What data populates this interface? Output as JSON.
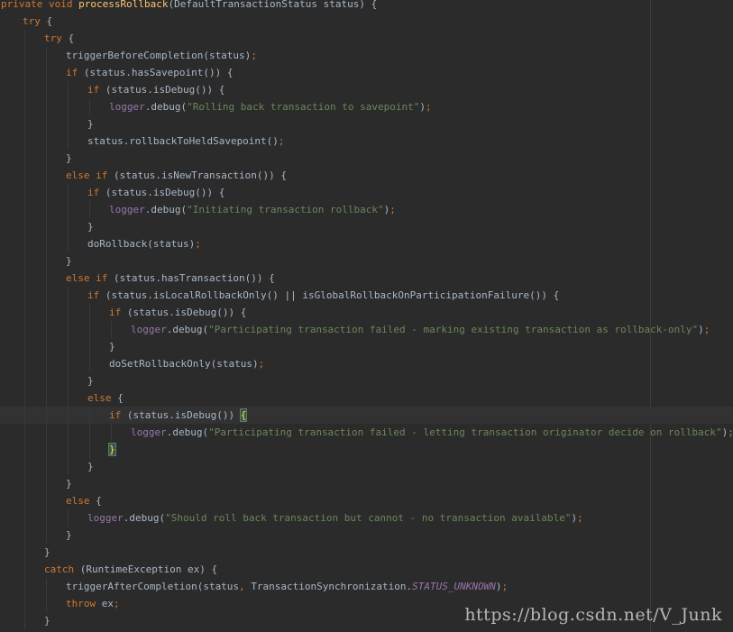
{
  "editor": {
    "colors": {
      "background": "#2b2b2b",
      "keyword": "#cc7832",
      "method": "#ffc66d",
      "string": "#6a8759",
      "field": "#9876aa",
      "text": "#a9b7c6"
    },
    "lines": [
      {
        "indent": 1,
        "tokens": [
          {
            "t": "private ",
            "c": "kw"
          },
          {
            "t": "void ",
            "c": "kw"
          },
          {
            "t": "processRollback",
            "c": "fn"
          },
          {
            "t": "(DefaultTransactionStatus status) {"
          }
        ]
      },
      {
        "indent": 2,
        "tokens": [
          {
            "t": "try ",
            "c": "kw"
          },
          {
            "t": "{"
          }
        ]
      },
      {
        "indent": 3,
        "tokens": [
          {
            "t": "try ",
            "c": "kw"
          },
          {
            "t": "{"
          }
        ]
      },
      {
        "indent": 4,
        "tokens": [
          {
            "t": "triggerBeforeCompletion(status)"
          },
          {
            "t": ";",
            "c": "punc"
          }
        ]
      },
      {
        "indent": 4,
        "tokens": [
          {
            "t": "if ",
            "c": "kw"
          },
          {
            "t": "(status.hasSavepoint()) {"
          }
        ]
      },
      {
        "indent": 5,
        "tokens": [
          {
            "t": "if ",
            "c": "kw"
          },
          {
            "t": "(status.isDebug()) {"
          }
        ]
      },
      {
        "indent": 6,
        "tokens": [
          {
            "t": "logger",
            "c": "field"
          },
          {
            "t": ".debug("
          },
          {
            "t": "\"Rolling back transaction to savepoint\"",
            "c": "str"
          },
          {
            "t": ")"
          },
          {
            "t": ";",
            "c": "punc"
          }
        ]
      },
      {
        "indent": 5,
        "tokens": [
          {
            "t": "}"
          }
        ]
      },
      {
        "indent": 5,
        "tokens": [
          {
            "t": "status.rollbackToHeldSavepoint()"
          },
          {
            "t": ";",
            "c": "punc"
          }
        ]
      },
      {
        "indent": 4,
        "tokens": [
          {
            "t": "}"
          }
        ]
      },
      {
        "indent": 4,
        "tokens": [
          {
            "t": "else if ",
            "c": "kw"
          },
          {
            "t": "(status.isNewTransaction()) {"
          }
        ]
      },
      {
        "indent": 5,
        "tokens": [
          {
            "t": "if ",
            "c": "kw"
          },
          {
            "t": "(status.isDebug()) {"
          }
        ]
      },
      {
        "indent": 6,
        "tokens": [
          {
            "t": "logger",
            "c": "field"
          },
          {
            "t": ".debug("
          },
          {
            "t": "\"Initiating transaction rollback\"",
            "c": "str"
          },
          {
            "t": ")"
          },
          {
            "t": ";",
            "c": "punc"
          }
        ]
      },
      {
        "indent": 5,
        "tokens": [
          {
            "t": "}"
          }
        ]
      },
      {
        "indent": 5,
        "tokens": [
          {
            "t": "doRollback(status)"
          },
          {
            "t": ";",
            "c": "punc"
          }
        ]
      },
      {
        "indent": 4,
        "tokens": [
          {
            "t": "}"
          }
        ]
      },
      {
        "indent": 4,
        "tokens": [
          {
            "t": "else if ",
            "c": "kw"
          },
          {
            "t": "(status.hasTransaction()) {"
          }
        ]
      },
      {
        "indent": 5,
        "tokens": [
          {
            "t": "if ",
            "c": "kw"
          },
          {
            "t": "(status.isLocalRollbackOnly() || isGlobalRollbackOnParticipationFailure()) {"
          }
        ]
      },
      {
        "indent": 6,
        "tokens": [
          {
            "t": "if ",
            "c": "kw"
          },
          {
            "t": "(status.isDebug()) {"
          }
        ]
      },
      {
        "indent": 7,
        "tokens": [
          {
            "t": "logger",
            "c": "field"
          },
          {
            "t": ".debug("
          },
          {
            "t": "\"Participating transaction failed - marking existing transaction as rollback-only\"",
            "c": "str"
          },
          {
            "t": ")"
          },
          {
            "t": ";",
            "c": "punc"
          }
        ]
      },
      {
        "indent": 6,
        "tokens": [
          {
            "t": "}"
          }
        ]
      },
      {
        "indent": 6,
        "tokens": [
          {
            "t": "doSetRollbackOnly(status)"
          },
          {
            "t": ";",
            "c": "punc"
          }
        ]
      },
      {
        "indent": 5,
        "tokens": [
          {
            "t": "}"
          }
        ]
      },
      {
        "indent": 5,
        "tokens": [
          {
            "t": "else ",
            "c": "kw"
          },
          {
            "t": "{"
          }
        ]
      },
      {
        "indent": 6,
        "current": true,
        "tokens": [
          {
            "t": "if ",
            "c": "kw"
          },
          {
            "t": "(status.isDebug()) "
          },
          {
            "t": "{",
            "c": "match"
          }
        ]
      },
      {
        "indent": 7,
        "tokens": [
          {
            "t": "logger",
            "c": "field"
          },
          {
            "t": ".debug("
          },
          {
            "t": "\"Participating transaction failed - letting transaction originator decide on rollback\"",
            "c": "str"
          },
          {
            "t": ")"
          },
          {
            "t": ";",
            "c": "punc"
          }
        ]
      },
      {
        "indent": 6,
        "tokens": [
          {
            "t": "}",
            "c": "match"
          }
        ]
      },
      {
        "indent": 5,
        "tokens": [
          {
            "t": "}"
          }
        ]
      },
      {
        "indent": 4,
        "tokens": [
          {
            "t": "}"
          }
        ]
      },
      {
        "indent": 4,
        "tokens": [
          {
            "t": "else ",
            "c": "kw"
          },
          {
            "t": "{"
          }
        ]
      },
      {
        "indent": 5,
        "tokens": [
          {
            "t": "logger",
            "c": "field"
          },
          {
            "t": ".debug("
          },
          {
            "t": "\"Should roll back transaction but cannot - no transaction available\"",
            "c": "str"
          },
          {
            "t": ")"
          },
          {
            "t": ";",
            "c": "punc"
          }
        ]
      },
      {
        "indent": 4,
        "tokens": [
          {
            "t": "}"
          }
        ]
      },
      {
        "indent": 3,
        "tokens": [
          {
            "t": "}"
          }
        ]
      },
      {
        "indent": 3,
        "tokens": [
          {
            "t": "catch ",
            "c": "kw"
          },
          {
            "t": "(RuntimeException ex) {"
          }
        ]
      },
      {
        "indent": 4,
        "tokens": [
          {
            "t": "triggerAfterCompletion(status"
          },
          {
            "t": ", ",
            "c": "punc"
          },
          {
            "t": "TransactionSynchronization."
          },
          {
            "t": "STATUS_UNKNOWN",
            "c": "stat"
          },
          {
            "t": ")"
          },
          {
            "t": ";",
            "c": "punc"
          }
        ]
      },
      {
        "indent": 4,
        "tokens": [
          {
            "t": "throw ",
            "c": "kw"
          },
          {
            "t": "ex"
          },
          {
            "t": ";",
            "c": "punc"
          }
        ]
      },
      {
        "indent": 3,
        "tokens": [
          {
            "t": "}"
          }
        ]
      }
    ]
  },
  "watermark": "https://blog.csdn.net/V_Junk"
}
